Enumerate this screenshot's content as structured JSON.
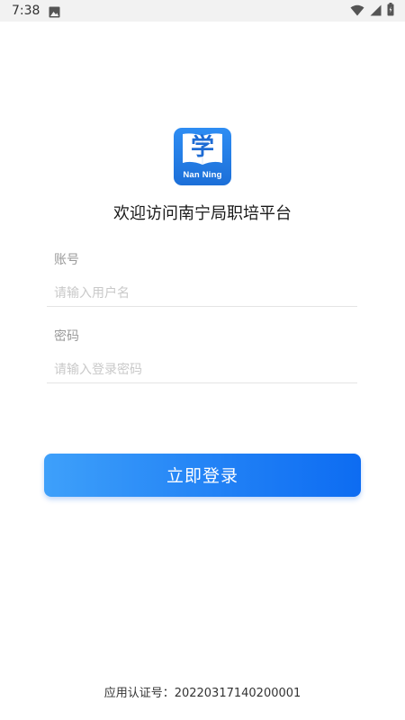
{
  "status_bar": {
    "time": "7:38",
    "icons": [
      "image-icon",
      "wifi-icon",
      "signal-icon",
      "battery-icon"
    ]
  },
  "logo": {
    "character": "学",
    "caption": "Nan Ning"
  },
  "welcome_text": "欢迎访问南宁局职培平台",
  "form": {
    "account": {
      "label": "账号",
      "placeholder": "请输入用户名",
      "value": ""
    },
    "password": {
      "label": "密码",
      "placeholder": "请输入登录密码",
      "value": ""
    },
    "login_button": "立即登录"
  },
  "footer": {
    "certification": "应用认证号：20220317140200001"
  },
  "colors": {
    "primary": "#1f7ff5",
    "label": "#9a9a9a",
    "placeholder": "#c9c9c9"
  }
}
